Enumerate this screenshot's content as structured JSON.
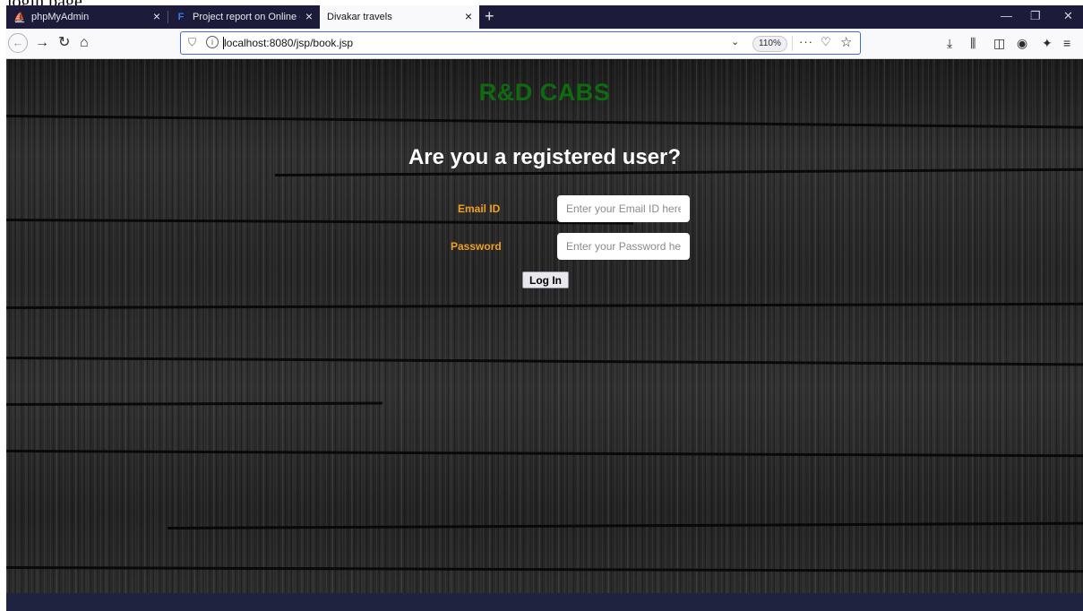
{
  "caption": "login page",
  "browser": {
    "tabs": [
      {
        "label": "phpMyAdmin",
        "icon": "phpmyadmin-icon",
        "active": false
      },
      {
        "label": "Project report on Online Car Re",
        "icon": "report-icon",
        "active": false
      },
      {
        "label": "Divakar travels",
        "icon": "",
        "active": true
      }
    ],
    "url": "localhost:8080/jsp/book.jsp",
    "zoom": "110%"
  },
  "page": {
    "brand": "R&D CABS",
    "heading": "Are you a registered user?",
    "email_label": "Email ID",
    "email_placeholder": "Enter your Email ID here",
    "password_label": "Password",
    "password_placeholder": "Enter your Password here",
    "login_label": "Log In"
  },
  "colors": {
    "brand": "#0f6b0f",
    "label": "#f0a020",
    "heading": "#ffffff"
  }
}
